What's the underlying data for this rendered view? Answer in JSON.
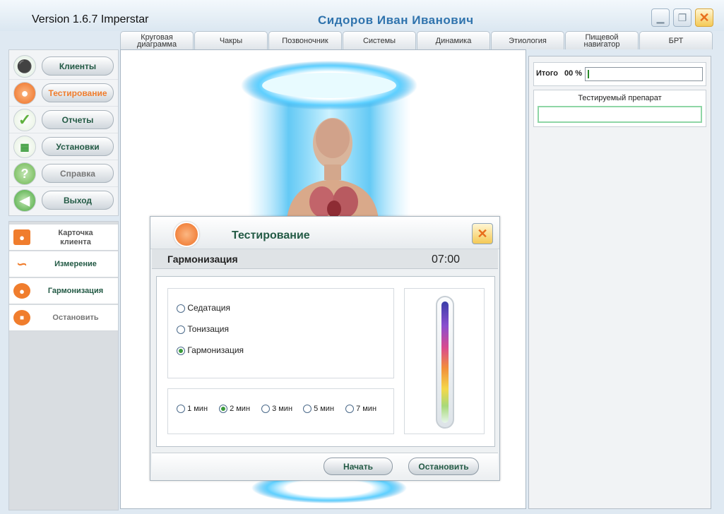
{
  "app": {
    "version": "Version 1.6.7 Imperstar",
    "user": "Сидоров  Иван  Иванович"
  },
  "window_controls": {
    "minimize": "▁",
    "restore": "❐",
    "close": "✕"
  },
  "tabs": [
    "Круговая\nдиаграмма",
    "Чакры",
    "Позвоночник",
    "Системы",
    "Динамика",
    "Этиология",
    "Пищевой\nнавигатор",
    "БРТ"
  ],
  "sidebar": {
    "nav": [
      {
        "label": "Клиенты",
        "icon": "person-icon",
        "icon_color": "#7bc36b"
      },
      {
        "label": "Тестирование",
        "icon": "user-orange-icon",
        "icon_color": "#f07d2d",
        "active": true
      },
      {
        "label": "Отчеты",
        "icon": "checkmark-icon",
        "icon_color": "#6abb44"
      },
      {
        "label": "Установки",
        "icon": "grid-icon",
        "icon_color": "#49a84a"
      },
      {
        "label": "Справка",
        "icon": "question-icon",
        "icon_color": "#7bc36b"
      },
      {
        "label": "Выход",
        "icon": "arrow-left-icon",
        "icon_color": "#4eae46"
      }
    ],
    "sub": [
      {
        "label": "Карточка\nклиента",
        "icon": "client-card-icon",
        "icon_color": "#f07d2d"
      },
      {
        "label": "Измерение",
        "icon": "measurement-chart-icon",
        "icon_color": "#f07d2d"
      },
      {
        "label": "Гармонизация",
        "icon": "harmonization-icon",
        "icon_color": "#f07d2d"
      },
      {
        "label": "Остановить",
        "icon": "stop-icon",
        "icon_color": "#f07d2d"
      }
    ]
  },
  "right_panel": {
    "total_label": "Итого",
    "total_value": "00 %",
    "progress": 0.01,
    "preparation_label": "Тестируемый препарат",
    "preparation_value": ""
  },
  "dialog": {
    "title": "Тестирование",
    "mode_title": "Гармонизация",
    "timer": "07:00",
    "modes": [
      {
        "label": "Седатация",
        "selected": false
      },
      {
        "label": "Тонизация",
        "selected": false
      },
      {
        "label": "Гармонизация",
        "selected": true
      }
    ],
    "durations": [
      {
        "label": "1 мин",
        "selected": false
      },
      {
        "label": "2 мин",
        "selected": true
      },
      {
        "label": "3 мин",
        "selected": false
      },
      {
        "label": "5 мин",
        "selected": false
      },
      {
        "label": "7 мин",
        "selected": false
      }
    ],
    "start_label": "Начать",
    "stop_label": "Остановить"
  }
}
